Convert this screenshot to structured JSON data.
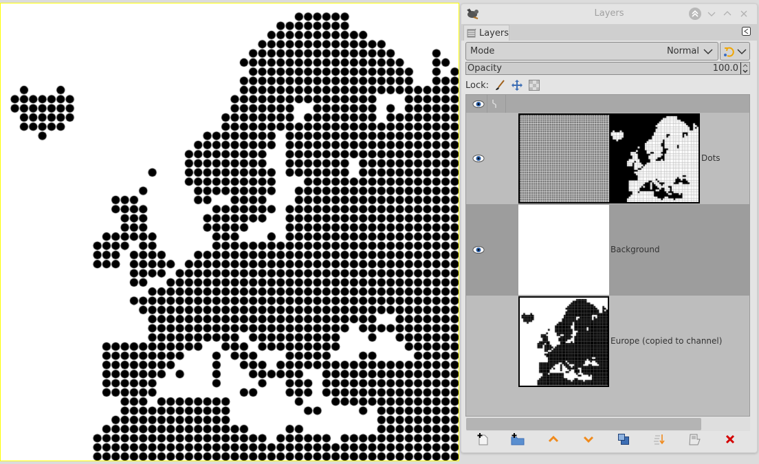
{
  "window": {
    "title": "Layers"
  },
  "tab": {
    "label": "Layers"
  },
  "mode": {
    "label": "Mode",
    "value": "Normal"
  },
  "opacity": {
    "label": "Opacity",
    "value": "100.0"
  },
  "lock": {
    "label": "Lock:"
  },
  "layers": [
    {
      "name": "Dots",
      "visible": true,
      "selected": false
    },
    {
      "name": "Background",
      "visible": true,
      "selected": true
    },
    {
      "name": "Europe (copied to channel)",
      "visible": false,
      "selected": false
    }
  ],
  "colors": {
    "accent_orange": "#f08a1c",
    "delete_red": "#d40000",
    "eye_blue": "#2a5fa8",
    "selected_row": "#9d9d9d",
    "row": "#bdbdbd"
  },
  "bottom_buttons": [
    "new-layer",
    "new-layer-group",
    "raise-layer",
    "lower-layer",
    "duplicate-layer",
    "merge-down",
    "add-mask",
    "delete-layer"
  ]
}
